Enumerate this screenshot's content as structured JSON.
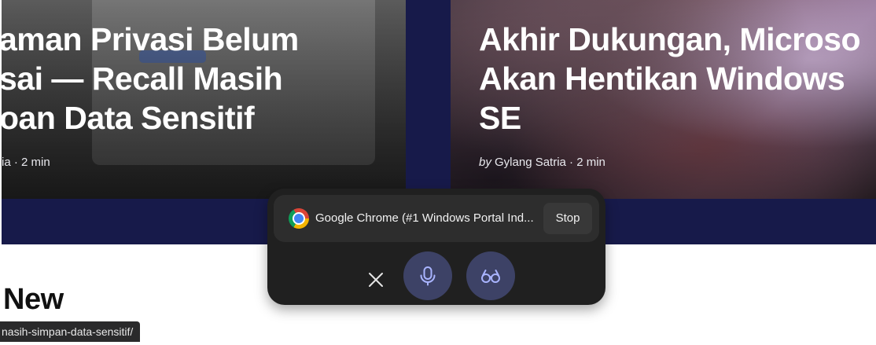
{
  "articles": [
    {
      "title_lines": [
        "aman Privasi Belum",
        "sai — Recall Masih",
        "oan Data Sensitif"
      ],
      "meta": "ia · 2 min"
    },
    {
      "title_lines": [
        "Akhir Dukungan, Microso",
        "Akan Hentikan Windows",
        "SE"
      ],
      "meta_by": "by",
      "meta_author": " Gylang Satria",
      "meta_rest": " · 2 min"
    }
  ],
  "section": {
    "heading": "New"
  },
  "status_bar": {
    "url": "nasih-simpan-data-sensitif/"
  },
  "share_panel": {
    "source_label": "Google Chrome (#1 Windows Portal Ind...",
    "stop_label": "Stop",
    "icons": [
      "chrome-icon",
      "close-icon",
      "microphone-icon",
      "glasses-icon"
    ]
  },
  "colors": {
    "hero_band": "#171a4a",
    "panel_bg": "#202020",
    "active_button": "#3d4266",
    "icon_accent": "#a9b4ff"
  }
}
